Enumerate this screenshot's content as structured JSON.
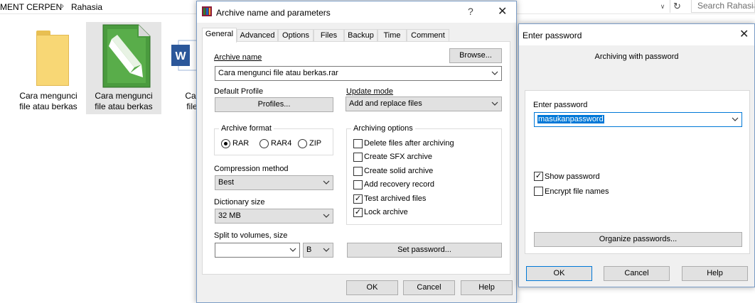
{
  "explorer": {
    "breadcrumb": [
      "MENT CERPEN",
      "Rahasia"
    ],
    "search_placeholder": "Search Rahasia",
    "files": [
      {
        "label_line1": "Cara mengunci",
        "label_line2": "file atau berkas",
        "icon": "folder-icon"
      },
      {
        "label_line1": "Cara mengunci",
        "label_line2": "file atau berkas",
        "icon": "winrar-archive-icon"
      },
      {
        "label_line1": "Cara m",
        "label_line2": "file ata",
        "icon": "word-document-icon"
      }
    ]
  },
  "archive_dialog": {
    "title": "Archive name and parameters",
    "help_glyph": "?",
    "tabs": [
      "General",
      "Advanced",
      "Options",
      "Files",
      "Backup",
      "Time",
      "Comment"
    ],
    "active_tab": "General",
    "archive_name_label": "Archive name",
    "browse_label": "Browse...",
    "archive_name_value": "Cara mengunci file atau berkas.rar",
    "default_profile_label": "Default Profile",
    "profiles_label": "Profiles...",
    "update_mode_label": "Update mode",
    "update_mode_value": "Add and replace files",
    "archive_format_label": "Archive format",
    "formats": [
      {
        "label": "RAR",
        "selected": true
      },
      {
        "label": "RAR4",
        "selected": false
      },
      {
        "label": "ZIP",
        "selected": false
      }
    ],
    "archiving_options_label": "Archiving options",
    "options": [
      {
        "label": "Delete files after archiving",
        "checked": false
      },
      {
        "label": "Create SFX archive",
        "checked": false
      },
      {
        "label": "Create solid archive",
        "checked": false
      },
      {
        "label": "Add recovery record",
        "checked": false
      },
      {
        "label": "Test archived files",
        "checked": true
      },
      {
        "label": "Lock archive",
        "checked": true
      }
    ],
    "compression_label": "Compression method",
    "compression_value": "Best",
    "dictionary_label": "Dictionary size",
    "dictionary_value": "32 MB",
    "split_label": "Split to volumes, size",
    "split_value": "",
    "split_unit": "B",
    "set_password_label": "Set password...",
    "ok_label": "OK",
    "cancel_label": "Cancel",
    "help_label": "Help"
  },
  "password_dialog": {
    "title": "Enter password",
    "heading": "Archiving with password",
    "enter_password_label": "Enter password",
    "password_value": "masukanpassword",
    "show_password_label": "Show password",
    "show_password_checked": true,
    "encrypt_names_label": "Encrypt file names",
    "encrypt_names_checked": false,
    "organize_label": "Organize passwords...",
    "ok_label": "OK",
    "cancel_label": "Cancel",
    "help_label": "Help"
  }
}
